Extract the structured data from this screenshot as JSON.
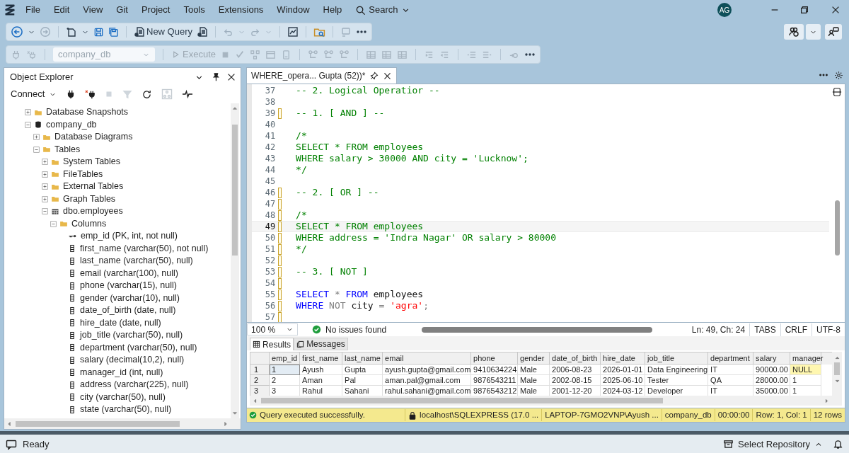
{
  "menu": {
    "items": [
      "File",
      "Edit",
      "View",
      "Git",
      "Project",
      "Tools",
      "Extensions",
      "Window",
      "Help"
    ],
    "search": "Search",
    "avatar": "AG"
  },
  "toolbar": {
    "new_query": "New Query",
    "database": "company_db",
    "execute": "Execute"
  },
  "object_explorer": {
    "title": "Object Explorer",
    "connect": "Connect",
    "tree": [
      {
        "label": "Database Snapshots",
        "kind": "folder",
        "expanded": false
      },
      {
        "label": "company_db",
        "kind": "database",
        "expanded": true,
        "children": [
          {
            "label": "Database Diagrams",
            "kind": "folder",
            "expanded": false
          },
          {
            "label": "Tables",
            "kind": "folder",
            "expanded": true,
            "children": [
              {
                "label": "System Tables",
                "kind": "folder",
                "expanded": false
              },
              {
                "label": "FileTables",
                "kind": "folder",
                "expanded": false
              },
              {
                "label": "External Tables",
                "kind": "folder",
                "expanded": false
              },
              {
                "label": "Graph Tables",
                "kind": "folder",
                "expanded": false
              },
              {
                "label": "dbo.employees",
                "kind": "table",
                "expanded": true,
                "children": [
                  {
                    "label": "Columns",
                    "kind": "folder",
                    "expanded": true,
                    "children": [
                      {
                        "label": "emp_id (PK, int, not null)",
                        "kind": "key"
                      },
                      {
                        "label": "first_name (varchar(50), not null)",
                        "kind": "column"
                      },
                      {
                        "label": "last_name (varchar(50), null)",
                        "kind": "column"
                      },
                      {
                        "label": "email (varchar(100), null)",
                        "kind": "column"
                      },
                      {
                        "label": "phone (varchar(15), null)",
                        "kind": "column"
                      },
                      {
                        "label": "gender (varchar(10), null)",
                        "kind": "column"
                      },
                      {
                        "label": "date_of_birth (date, null)",
                        "kind": "column"
                      },
                      {
                        "label": "hire_date (date, null)",
                        "kind": "column"
                      },
                      {
                        "label": "job_title (varchar(50), null)",
                        "kind": "column"
                      },
                      {
                        "label": "department (varchar(50), null)",
                        "kind": "column"
                      },
                      {
                        "label": "salary (decimal(10,2), null)",
                        "kind": "column"
                      },
                      {
                        "label": "manager_id (int, null)",
                        "kind": "column"
                      },
                      {
                        "label": "address (varchar(225), null)",
                        "kind": "column"
                      },
                      {
                        "label": "city (varchar(50), null)",
                        "kind": "column"
                      },
                      {
                        "label": "state (varchar(50), null)",
                        "kind": "column"
                      }
                    ]
                  }
                ]
              }
            ]
          }
        ]
      }
    ]
  },
  "editor": {
    "tab": "WHERE_opera... Gupta (52))*",
    "lines": [
      {
        "number": "37",
        "changed": false,
        "current": false,
        "segments": [
          {
            "text": "-- 2. Logical Operatior --",
            "kind": "comment"
          }
        ]
      },
      {
        "number": "38",
        "changed": false,
        "current": false
      },
      {
        "number": "39",
        "changed": true,
        "current": false,
        "segments": [
          {
            "text": "-- 1. [ AND ] --",
            "kind": "comment"
          }
        ]
      },
      {
        "number": "40",
        "changed": false,
        "current": false
      },
      {
        "number": "41",
        "changed": false,
        "current": false,
        "segments": [
          {
            "text": "/*",
            "kind": "comment"
          }
        ]
      },
      {
        "number": "42",
        "changed": false,
        "current": false,
        "segments": [
          {
            "text": "SELECT * FROM employees",
            "kind": "comment"
          }
        ]
      },
      {
        "number": "43",
        "changed": false,
        "current": false,
        "segments": [
          {
            "text": "WHERE salary > 30000 AND city = 'Lucknow';",
            "kind": "comment"
          }
        ]
      },
      {
        "number": "44",
        "changed": false,
        "current": false,
        "segments": [
          {
            "text": "*/",
            "kind": "comment"
          }
        ]
      },
      {
        "number": "45",
        "changed": false,
        "current": false
      },
      {
        "number": "46",
        "changed": true,
        "current": false,
        "segments": [
          {
            "text": "-- 2. [ OR ] --",
            "kind": "comment"
          }
        ]
      },
      {
        "number": "47",
        "changed": true,
        "current": false
      },
      {
        "number": "48",
        "changed": true,
        "current": false,
        "segments": [
          {
            "text": "/*",
            "kind": "comment"
          }
        ]
      },
      {
        "number": "49",
        "changed": true,
        "current": true,
        "segments": [
          {
            "text": "SELECT * FROM employees",
            "kind": "comment"
          }
        ]
      },
      {
        "number": "50",
        "changed": true,
        "current": false,
        "segments": [
          {
            "text": "WHERE address = 'Indra Nagar' OR salary > 80000",
            "kind": "comment"
          }
        ]
      },
      {
        "number": "51",
        "changed": true,
        "current": false,
        "segments": [
          {
            "text": "*/",
            "kind": "comment"
          }
        ]
      },
      {
        "number": "52",
        "changed": true,
        "current": false
      },
      {
        "number": "53",
        "changed": true,
        "current": false,
        "segments": [
          {
            "text": "-- 3. [ NOT ]",
            "kind": "comment"
          }
        ]
      },
      {
        "number": "54",
        "changed": true,
        "current": false
      },
      {
        "number": "55",
        "changed": true,
        "current": false,
        "segments": [
          {
            "text": "SELECT",
            "kind": "keyword"
          },
          {
            "text": " * ",
            "kind": "operator"
          },
          {
            "text": "FROM",
            "kind": "keyword"
          },
          {
            "text": " employees",
            "kind": "identifier"
          }
        ]
      },
      {
        "number": "56",
        "changed": true,
        "current": false,
        "segments": [
          {
            "text": "WHERE",
            "kind": "keyword"
          },
          {
            "text": " NOT ",
            "kind": "operator"
          },
          {
            "text": "city",
            "kind": "identifier"
          },
          {
            "text": " = ",
            "kind": "operator"
          },
          {
            "text": "'agra'",
            "kind": "string"
          },
          {
            "text": ";",
            "kind": "operator"
          }
        ]
      },
      {
        "number": "57",
        "changed": true,
        "current": false
      }
    ],
    "zoom": "100 %",
    "issues": "No issues found",
    "position": "Ln: 49, Ch: 24",
    "indent": "TABS",
    "line_ending": "CRLF",
    "encoding": "UTF-8"
  },
  "results": {
    "tabs": [
      {
        "label": "Results",
        "selected": true
      },
      {
        "label": "Messages",
        "selected": false
      }
    ],
    "columns": [
      "emp_id",
      "first_name",
      "last_name",
      "email",
      "phone",
      "gender",
      "date_of_birth",
      "hire_date",
      "job_title",
      "department",
      "salary",
      "manager"
    ],
    "rows": [
      {
        "number": "1",
        "cells": [
          {
            "text": "1",
            "selected": true,
            "is_null": false
          },
          {
            "text": "Ayush",
            "selected": false,
            "is_null": false
          },
          {
            "text": "Gupta",
            "selected": false,
            "is_null": false
          },
          {
            "text": "ayush.gupta@gmail.com",
            "selected": false,
            "is_null": false
          },
          {
            "text": "9410634224",
            "selected": false,
            "is_null": false
          },
          {
            "text": "Male",
            "selected": false,
            "is_null": false
          },
          {
            "text": "2006-08-23",
            "selected": false,
            "is_null": false
          },
          {
            "text": "2026-01-01",
            "selected": false,
            "is_null": false
          },
          {
            "text": "Data Engineering",
            "selected": false,
            "is_null": false
          },
          {
            "text": "IT",
            "selected": false,
            "is_null": false
          },
          {
            "text": "90000.00",
            "selected": false,
            "is_null": false
          },
          {
            "text": "NULL",
            "selected": false,
            "is_null": true
          }
        ]
      },
      {
        "number": "2",
        "cells": [
          {
            "text": "2",
            "selected": false,
            "is_null": false
          },
          {
            "text": "Aman",
            "selected": false,
            "is_null": false
          },
          {
            "text": "Pal",
            "selected": false,
            "is_null": false
          },
          {
            "text": "aman.pal@gmail.com",
            "selected": false,
            "is_null": false
          },
          {
            "text": "9876543211",
            "selected": false,
            "is_null": false
          },
          {
            "text": "Male",
            "selected": false,
            "is_null": false
          },
          {
            "text": "2002-08-15",
            "selected": false,
            "is_null": false
          },
          {
            "text": "2025-06-10",
            "selected": false,
            "is_null": false
          },
          {
            "text": "Tester",
            "selected": false,
            "is_null": false
          },
          {
            "text": "QA",
            "selected": false,
            "is_null": false
          },
          {
            "text": "28000.00",
            "selected": false,
            "is_null": false
          },
          {
            "text": "1",
            "selected": false,
            "is_null": false
          }
        ]
      },
      {
        "number": "3",
        "cells": [
          {
            "text": "3",
            "selected": false,
            "is_null": false
          },
          {
            "text": "Rahul",
            "selected": false,
            "is_null": false
          },
          {
            "text": "Sahani",
            "selected": false,
            "is_null": false
          },
          {
            "text": "rahul.sahani@gmail.com",
            "selected": false,
            "is_null": false
          },
          {
            "text": "9876543212",
            "selected": false,
            "is_null": false
          },
          {
            "text": "Male",
            "selected": false,
            "is_null": false
          },
          {
            "text": "2001-12-20",
            "selected": false,
            "is_null": false
          },
          {
            "text": "2024-03-12",
            "selected": false,
            "is_null": false
          },
          {
            "text": "Developer",
            "selected": false,
            "is_null": false
          },
          {
            "text": "IT",
            "selected": false,
            "is_null": false
          },
          {
            "text": "35000.00",
            "selected": false,
            "is_null": false
          },
          {
            "text": "1",
            "selected": false,
            "is_null": false
          }
        ]
      }
    ]
  },
  "query_status": {
    "message": "Query executed successfully.",
    "server": "localhost\\SQLEXPRESS (17.0 ...",
    "user": "LAPTOP-7GMO2VNP\\Ayush ...",
    "database": "company_db",
    "elapsed": "00:00:00",
    "position": "Row: 1, Col: 1",
    "row_count": "12 rows"
  },
  "status_bar": {
    "text": "Ready",
    "repository": "Select Repository"
  }
}
